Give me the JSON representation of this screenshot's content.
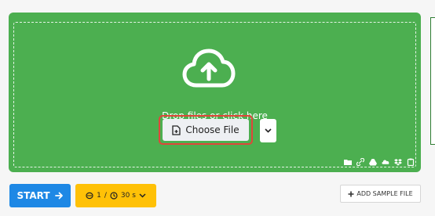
{
  "dropzone": {
    "prompt": "Drop files or click here",
    "choose_label": "Choose File",
    "background": "#4caf50",
    "highlight_border": "#e0463a",
    "source_icons": [
      "folder-icon",
      "link-icon",
      "google-drive-icon",
      "onedrive-icon",
      "dropbox-icon",
      "clipboard-icon"
    ]
  },
  "actions": {
    "start_label": "START",
    "options_count": "1",
    "options_separator": "/",
    "options_time": "30 s",
    "sample_label": "ADD SAMPLE FILE"
  },
  "colors": {
    "start": "#1e88e5",
    "options": "#ffc107"
  }
}
